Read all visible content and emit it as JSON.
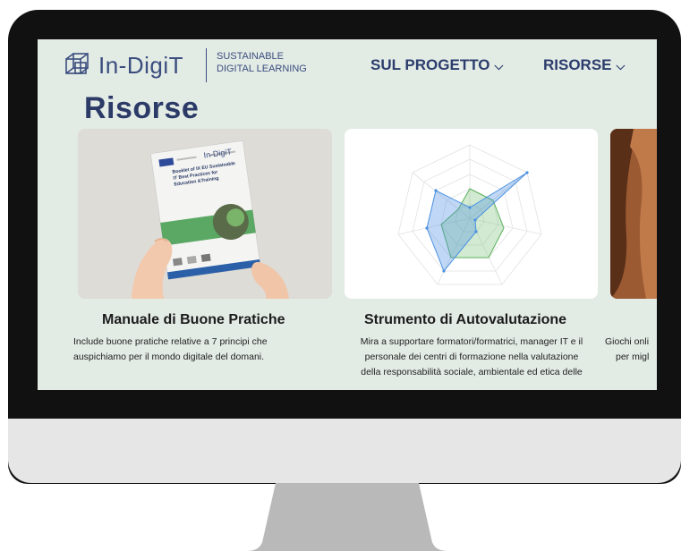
{
  "header": {
    "brand": "In-DigiT",
    "tagline_line1": "SUSTAINABLE",
    "tagline_line2": "DIGITAL LEARNING",
    "nav": [
      {
        "label": "SUL PROGETTO"
      },
      {
        "label": "RISORSE"
      }
    ]
  },
  "page": {
    "title": "Risorse"
  },
  "cards": [
    {
      "title": "Manuale di Buone Pratiche",
      "lines": [
        "Include buone pratiche relative a 7 principi che",
        "auspichiamo per il mondo digitale del domani."
      ],
      "booklet": {
        "brand": "In-DigiT",
        "title_lines": [
          "Booklet of IX EU Sustainable",
          "IT Best Practices for",
          "Education &Training"
        ]
      }
    },
    {
      "title": "Strumento di Autovalutazione",
      "lines": [
        "Mira a supportare formatori/formatrici, manager IT e il",
        "personale dei centri di formazione nella valutazione",
        "della responsabilità sociale, ambientale ed etica delle"
      ]
    },
    {
      "lines": [
        "Giochi onli",
        "per migl"
      ]
    }
  ],
  "colors": {
    "background": "#e3ebe5",
    "brand": "#3a4d7e",
    "radar_blue": "#4a90e2",
    "radar_green": "#7cc47c"
  }
}
